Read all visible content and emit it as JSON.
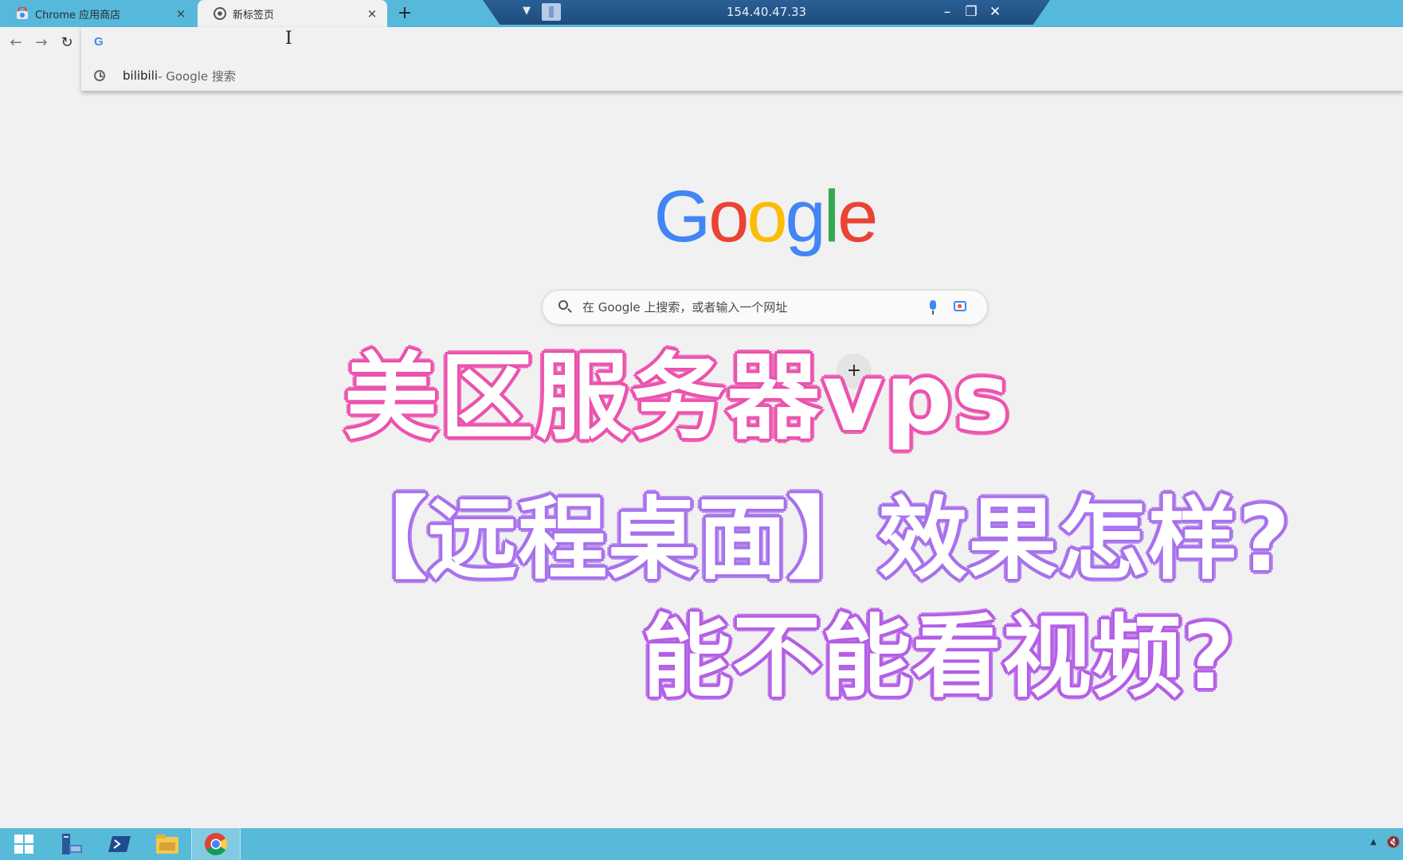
{
  "browser": {
    "tabs": [
      {
        "title": "Chrome 应用商店",
        "favicon": "chrome-webstore-icon",
        "active": false,
        "close": "×"
      },
      {
        "title": "新标签页",
        "favicon": "chrome-icon",
        "active": true,
        "close": "×"
      }
    ],
    "new_tab": "+"
  },
  "remote_desktop": {
    "host": "154.40.47.33",
    "menu": "▼",
    "minimize": "–",
    "restore": "❐",
    "close": "✕"
  },
  "toolbar": {
    "back": "←",
    "forward": "→",
    "reload": "↻"
  },
  "omnibox": {
    "provider": "G",
    "suggestions": [
      {
        "text": "bilibili",
        "sub": " - Google 搜索",
        "icon": "history-clock-icon"
      }
    ]
  },
  "ntp": {
    "logo_letters": [
      {
        "ch": "G",
        "color": "#4285f4"
      },
      {
        "ch": "o",
        "color": "#ea4335"
      },
      {
        "ch": "o",
        "color": "#fbbc05"
      },
      {
        "ch": "g",
        "color": "#4285f4"
      },
      {
        "ch": "l",
        "color": "#34a853"
      },
      {
        "ch": "e",
        "color": "#ea4335"
      }
    ],
    "search_placeholder": "在 Google 上搜索，或者输入一个网址",
    "add_shortcut": "+"
  },
  "overlay": {
    "line1": "美区服务器vps",
    "line2": "【远程桌面】效果怎样?",
    "line3": "能不能看视频?"
  },
  "taskbar": {
    "items": [
      "start-icon",
      "server-manager-icon",
      "powershell-icon",
      "file-explorer-icon",
      "chrome-icon"
    ],
    "tray_arrow": "▲",
    "tray_volume": "🔇"
  }
}
